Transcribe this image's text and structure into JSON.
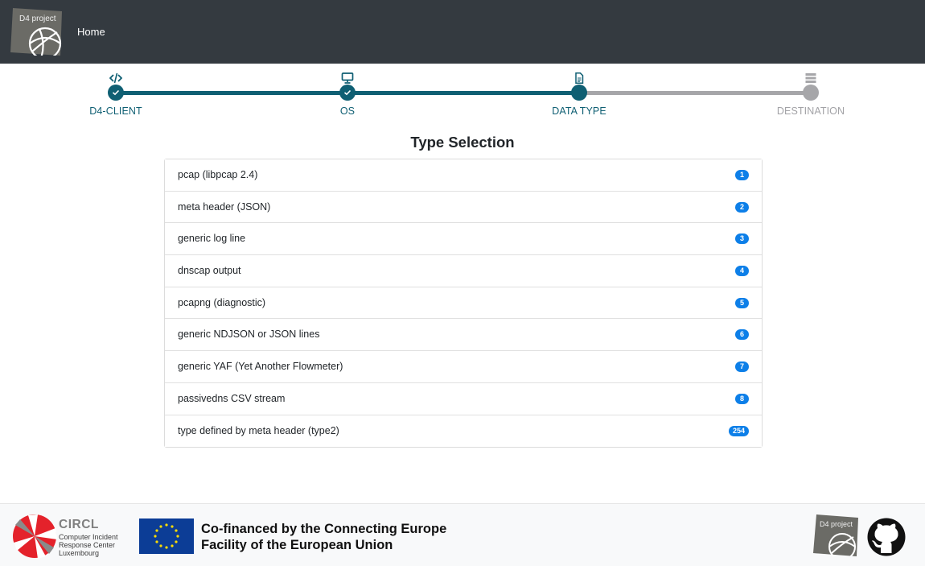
{
  "header": {
    "logo_text": "D4 project",
    "nav_home": "Home"
  },
  "stepper": {
    "steps": [
      {
        "label": "D4-CLIENT",
        "icon": "code-icon",
        "state": "done"
      },
      {
        "label": "OS",
        "icon": "monitor-icon",
        "state": "done"
      },
      {
        "label": "DATA TYPE",
        "icon": "file-icon",
        "state": "active"
      },
      {
        "label": "DESTINATION",
        "icon": "server-icon",
        "state": "todo"
      }
    ],
    "colors": {
      "done": "#0f5f73",
      "todo": "#a6a6a9"
    }
  },
  "main": {
    "title": "Type Selection",
    "types": [
      {
        "label": "pcap (libpcap 2.4)",
        "badge": "1"
      },
      {
        "label": "meta header (JSON)",
        "badge": "2"
      },
      {
        "label": "generic log line",
        "badge": "3"
      },
      {
        "label": "dnscap output",
        "badge": "4"
      },
      {
        "label": "pcapng (diagnostic)",
        "badge": "5"
      },
      {
        "label": "generic NDJSON or JSON lines",
        "badge": "6"
      },
      {
        "label": "generic YAF (Yet Another Flowmeter)",
        "badge": "7"
      },
      {
        "label": "passivedns CSV stream",
        "badge": "8"
      },
      {
        "label": "type defined by meta header (type2)",
        "badge": "254"
      }
    ],
    "badge_color": "#0d7fe8"
  },
  "footer": {
    "circl_name": "CIRCL",
    "circl_sub": "Computer Incident Response Center Luxembourg",
    "cofinanced": "Co-financed by the Connecting Europe Facility of the European Union",
    "d4_logo_text": "D4 project",
    "icons": [
      "circl-logo-icon",
      "eu-flag-icon",
      "d4-logo-icon",
      "github-icon"
    ]
  }
}
